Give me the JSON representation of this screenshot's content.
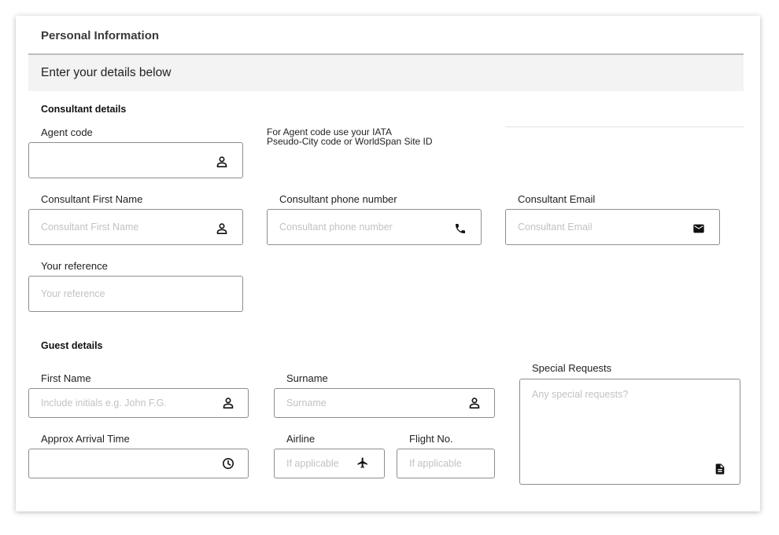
{
  "header": {
    "title": "Personal Information",
    "subtitle": "Enter your details below"
  },
  "consultant": {
    "section_title": "Consultant details",
    "agent_code": {
      "label": "Agent code",
      "placeholder": "",
      "value": "",
      "icon": "person-icon"
    },
    "agent_hint_line1": "For Agent code use your IATA",
    "agent_hint_line2": "Pseudo-City code or WorldSpan Site ID",
    "first_name": {
      "label": "Consultant First Name",
      "placeholder": "Consultant First Name",
      "icon": "person-icon"
    },
    "phone": {
      "label": "Consultant phone number",
      "placeholder": "Consultant phone number",
      "icon": "phone-icon"
    },
    "email": {
      "label": "Consultant Email",
      "placeholder": "Consultant Email",
      "icon": "mail-icon"
    },
    "reference": {
      "label": "Your reference",
      "placeholder": "Your reference"
    }
  },
  "guest": {
    "section_title": "Guest details",
    "first_name": {
      "label": "First Name",
      "placeholder": "Include initials e.g. John F.G.",
      "icon": "person-icon"
    },
    "surname": {
      "label": "Surname",
      "placeholder": "Surname",
      "icon": "person-icon"
    },
    "special_requests": {
      "label": "Special Requests",
      "placeholder": "Any special requests?",
      "icon": "document-icon"
    },
    "arrival_time": {
      "label": "Approx Arrival Time",
      "placeholder": "",
      "icon": "clock-icon"
    },
    "airline": {
      "label": "Airline",
      "placeholder": "If applicable",
      "icon": "airplane-icon"
    },
    "flight_no": {
      "label": "Flight No.",
      "placeholder": "If applicable"
    }
  }
}
